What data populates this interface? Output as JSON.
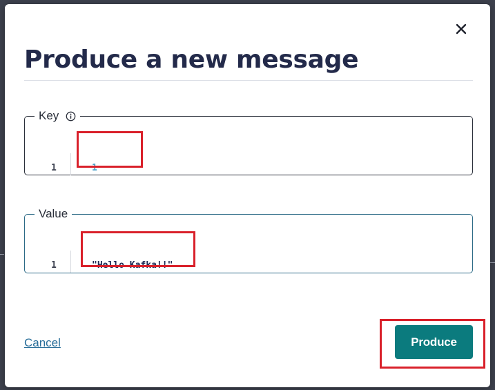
{
  "dialog": {
    "title": "Produce a new message",
    "close_icon": "close-icon"
  },
  "key_editor": {
    "label": "Key",
    "info_icon": "info-icon",
    "lines": [
      {
        "number": "1",
        "text": "1"
      }
    ]
  },
  "value_editor": {
    "label": "Value",
    "lines": [
      {
        "number": "1",
        "text": "\"Hello Kafka!!\""
      }
    ]
  },
  "footer": {
    "cancel_label": "Cancel",
    "produce_label": "Produce"
  },
  "colors": {
    "accent": "#0b7b7e",
    "title": "#232a4a",
    "link": "#2a6f9a",
    "annotation_highlight": "#d9202a",
    "key_text": "#4ea3c9"
  }
}
